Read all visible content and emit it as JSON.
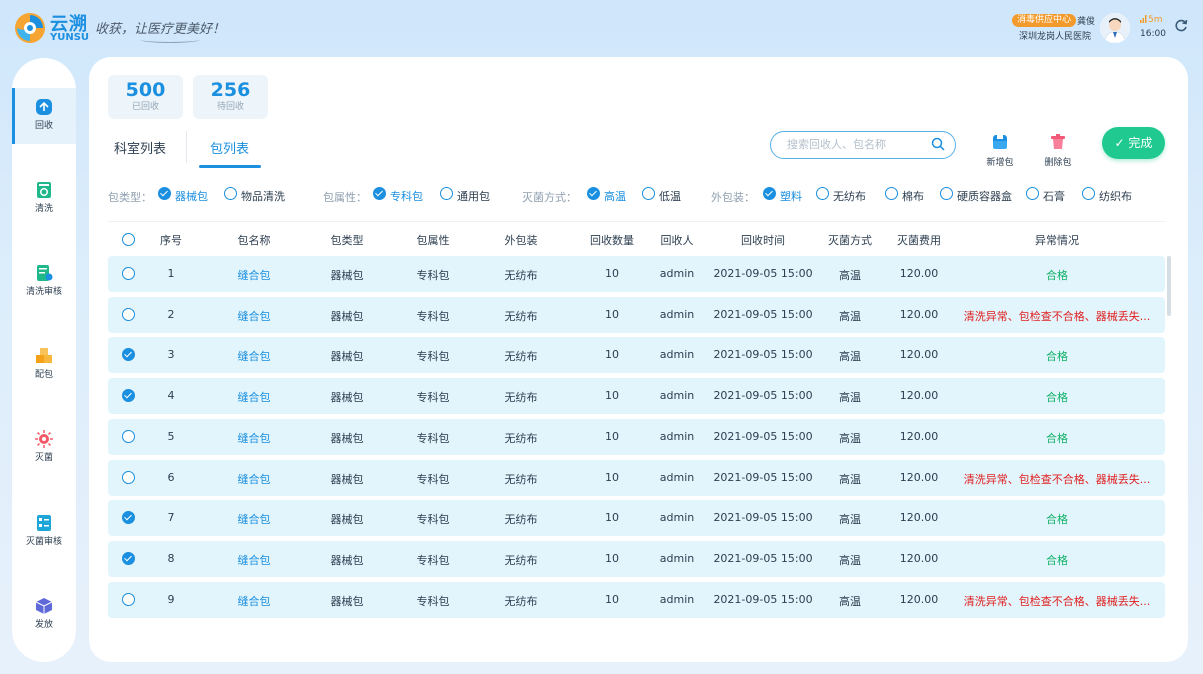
{
  "header": {
    "brand_cn": "云溯",
    "brand_en": "YUNSU",
    "slogan": "收获，让医疗更美好！",
    "dept_badge": "消毒供应中心",
    "user_name": "龚俊",
    "hospital": "深圳龙岗人民医院",
    "signal": "5m",
    "time": "16:00"
  },
  "sidebar": {
    "items": [
      {
        "label": "回收",
        "icon": "recycle-icon"
      },
      {
        "label": "清洗",
        "icon": "wash-icon"
      },
      {
        "label": "清洗审核",
        "icon": "wash-audit-icon"
      },
      {
        "label": "配包",
        "icon": "pack-icon"
      },
      {
        "label": "灭菌",
        "icon": "sterilize-icon"
      },
      {
        "label": "灭菌审核",
        "icon": "sterilize-audit-icon"
      },
      {
        "label": "发放",
        "icon": "dispatch-icon"
      }
    ]
  },
  "stats": [
    {
      "value": "500",
      "label": "已回收"
    },
    {
      "value": "256",
      "label": "待回收"
    }
  ],
  "tabs": [
    {
      "label": "科室列表"
    },
    {
      "label": "包列表"
    }
  ],
  "search": {
    "placeholder": "搜索回收人、包名称"
  },
  "toolbar": {
    "add_label": "新增包",
    "delete_label": "删除包",
    "done_label": "完成"
  },
  "filters": {
    "pack_type": {
      "label": "包类型：",
      "options": [
        {
          "text": "器械包",
          "checked": true
        },
        {
          "text": "物品清洗",
          "checked": false
        }
      ]
    },
    "pack_attr": {
      "label": "包属性：",
      "options": [
        {
          "text": "专科包",
          "checked": true
        },
        {
          "text": "通用包",
          "checked": false
        }
      ]
    },
    "sterilize": {
      "label": "灭菌方式：",
      "options": [
        {
          "text": "高温",
          "checked": true
        },
        {
          "text": "低温",
          "checked": false
        }
      ]
    },
    "wrap": {
      "label": "外包装：",
      "options": [
        {
          "text": "塑料",
          "checked": true
        },
        {
          "text": "无纺布",
          "checked": false
        },
        {
          "text": "棉布",
          "checked": false
        },
        {
          "text": "硬质容器盒",
          "checked": false
        },
        {
          "text": "石膏",
          "checked": false
        },
        {
          "text": "纺织布",
          "checked": false
        }
      ]
    }
  },
  "table": {
    "headers": [
      "序号",
      "包名称",
      "包类型",
      "包属性",
      "外包装",
      "回收数量",
      "回收人",
      "回收时间",
      "灭菌方式",
      "灭菌费用",
      "异常情况"
    ],
    "rows": [
      {
        "checked": false,
        "no": "1",
        "name": "缝合包",
        "type": "器械包",
        "attr": "专科包",
        "wrap": "无纺布",
        "qty": "10",
        "user": "admin",
        "time": "2021-09-05 15:00",
        "method": "高温",
        "fee": "120.00",
        "status": "合格",
        "abnormal": false
      },
      {
        "checked": false,
        "no": "2",
        "name": "缝合包",
        "type": "器械包",
        "attr": "专科包",
        "wrap": "无纺布",
        "qty": "10",
        "user": "admin",
        "time": "2021-09-05 15:00",
        "method": "高温",
        "fee": "120.00",
        "status": "清洗异常、包检查不合格、器械丢失...",
        "abnormal": true
      },
      {
        "checked": true,
        "no": "3",
        "name": "缝合包",
        "type": "器械包",
        "attr": "专科包",
        "wrap": "无纺布",
        "qty": "10",
        "user": "admin",
        "time": "2021-09-05 15:00",
        "method": "高温",
        "fee": "120.00",
        "status": "合格",
        "abnormal": false
      },
      {
        "checked": true,
        "no": "4",
        "name": "缝合包",
        "type": "器械包",
        "attr": "专科包",
        "wrap": "无纺布",
        "qty": "10",
        "user": "admin",
        "time": "2021-09-05 15:00",
        "method": "高温",
        "fee": "120.00",
        "status": "合格",
        "abnormal": false
      },
      {
        "checked": false,
        "no": "5",
        "name": "缝合包",
        "type": "器械包",
        "attr": "专科包",
        "wrap": "无纺布",
        "qty": "10",
        "user": "admin",
        "time": "2021-09-05 15:00",
        "method": "高温",
        "fee": "120.00",
        "status": "合格",
        "abnormal": false
      },
      {
        "checked": false,
        "no": "6",
        "name": "缝合包",
        "type": "器械包",
        "attr": "专科包",
        "wrap": "无纺布",
        "qty": "10",
        "user": "admin",
        "time": "2021-09-05 15:00",
        "method": "高温",
        "fee": "120.00",
        "status": "清洗异常、包检查不合格、器械丢失...",
        "abnormal": true
      },
      {
        "checked": true,
        "no": "7",
        "name": "缝合包",
        "type": "器械包",
        "attr": "专科包",
        "wrap": "无纺布",
        "qty": "10",
        "user": "admin",
        "time": "2021-09-05 15:00",
        "method": "高温",
        "fee": "120.00",
        "status": "合格",
        "abnormal": false
      },
      {
        "checked": true,
        "no": "8",
        "name": "缝合包",
        "type": "器械包",
        "attr": "专科包",
        "wrap": "无纺布",
        "qty": "10",
        "user": "admin",
        "time": "2021-09-05 15:00",
        "method": "高温",
        "fee": "120.00",
        "status": "合格",
        "abnormal": false
      },
      {
        "checked": false,
        "no": "9",
        "name": "缝合包",
        "type": "器械包",
        "attr": "专科包",
        "wrap": "无纺布",
        "qty": "10",
        "user": "admin",
        "time": "2021-09-05 15:00",
        "method": "高温",
        "fee": "120.00",
        "status": "清洗异常、包检查不合格、器械丢失...",
        "abnormal": true
      }
    ]
  },
  "colors": {
    "accent": "#1b8fe0",
    "ok": "#10b066",
    "error": "#e02020",
    "done": "#1fc98f",
    "row_bg": "#e2f5fc",
    "badge": "#f39a2c"
  }
}
